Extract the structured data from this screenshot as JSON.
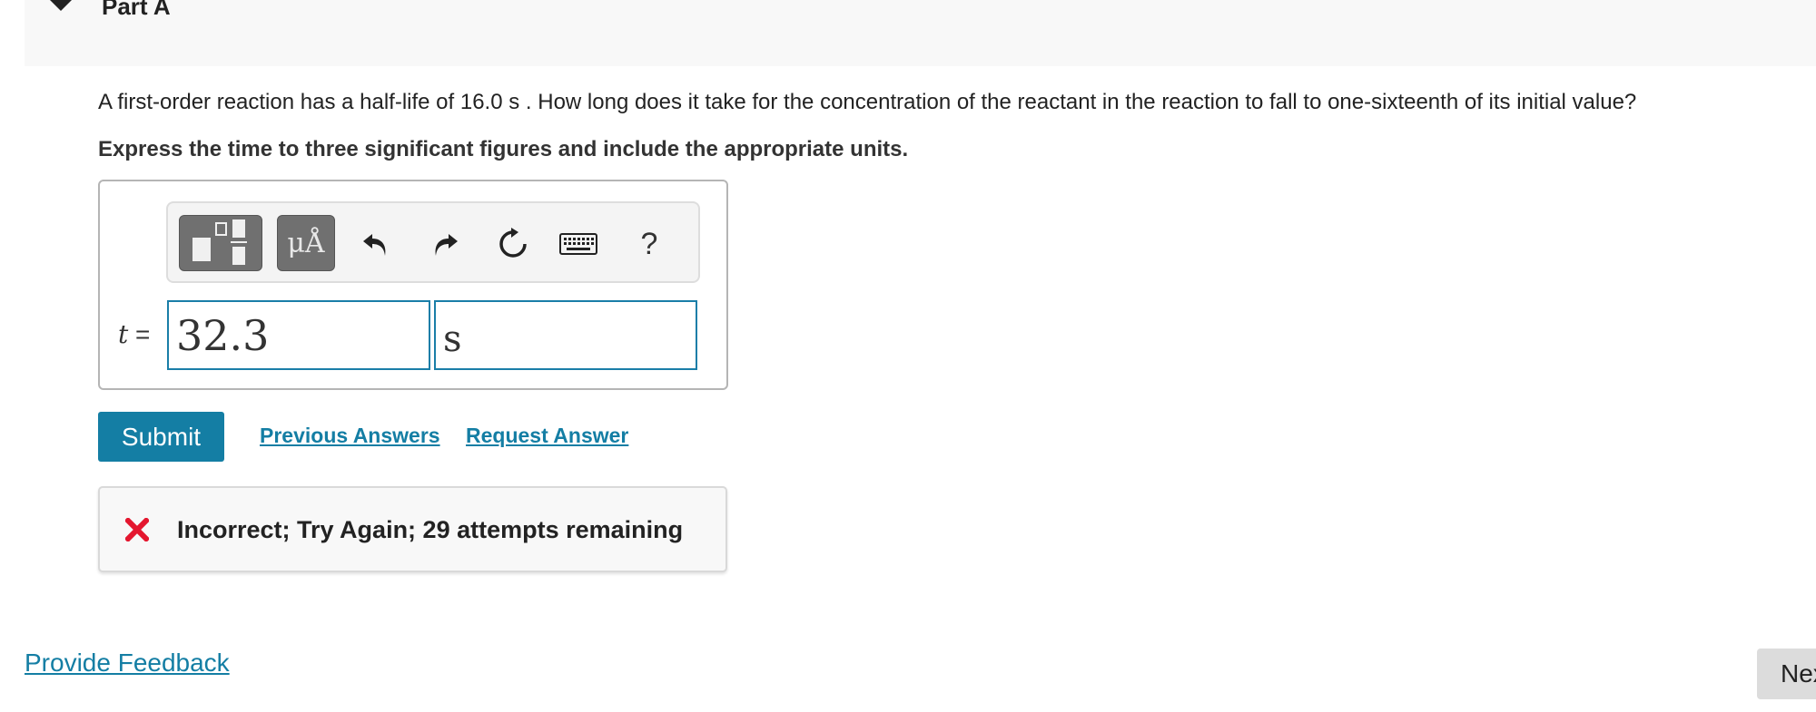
{
  "part": {
    "title": "Part A"
  },
  "question": {
    "text": "A first-order reaction has a half-life of 16.0 s . How long does it take for the concentration of the reactant in the reaction to fall to one-sixteenth of its initial value?",
    "instruction": "Express the time to three significant figures and include the appropriate units."
  },
  "toolbar": {
    "templates_icon": "fraction-templates-icon",
    "symbols_label": "μÅ",
    "undo_icon": "undo-icon",
    "redo_icon": "redo-icon",
    "reset_icon": "reset-icon",
    "keyboard_icon": "keyboard-icon",
    "help_label": "?"
  },
  "answer": {
    "variable": "t",
    "equals": "=",
    "value": "32.3",
    "unit": "s"
  },
  "actions": {
    "submit_label": "Submit",
    "previous_answers_label": "Previous Answers",
    "request_answer_label": "Request Answer"
  },
  "feedback": {
    "status_icon": "x-mark-icon",
    "message": "Incorrect; Try Again; 29 attempts remaining"
  },
  "footer": {
    "provide_feedback_label": "Provide Feedback",
    "next_label": "Next"
  },
  "colors": {
    "accent": "#147ea4",
    "error": "#e4172f",
    "header_bg": "#f8f8f8"
  }
}
